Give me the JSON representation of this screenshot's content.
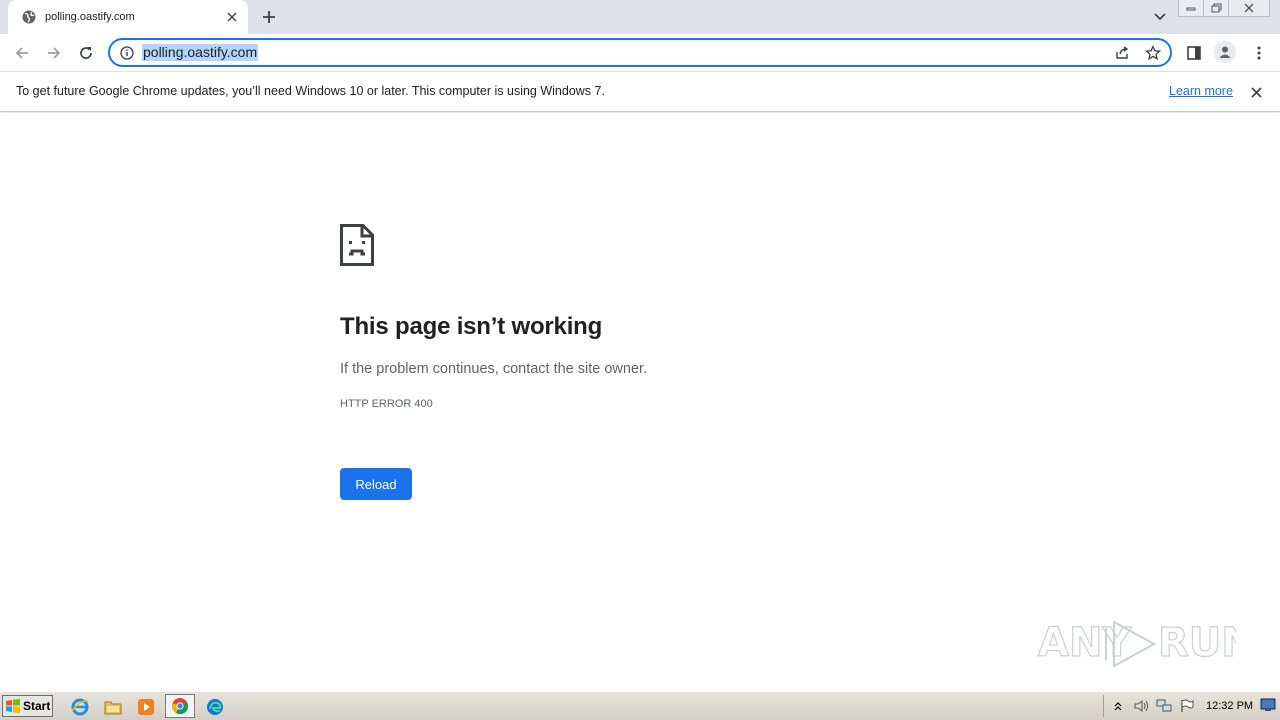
{
  "browser": {
    "tab": {
      "title": "polling.oastify.com"
    },
    "address_bar": {
      "url": "polling.oastify.com"
    },
    "infobar": {
      "message": "To get future Google Chrome updates, you’ll need Windows 10 or later. This computer is using Windows 7.",
      "link_label": "Learn more"
    }
  },
  "error_page": {
    "title": "This page isn’t working",
    "description": "If the problem continues, contact the site owner.",
    "error_code": "HTTP ERROR 400",
    "reload_label": "Reload"
  },
  "watermark": {
    "text": "ANY.RUN"
  },
  "taskbar": {
    "start_label": "Start",
    "clock": "12:32 PM",
    "apps": [
      "internet-explorer",
      "file-explorer",
      "media-player",
      "chrome",
      "edge"
    ]
  },
  "colors": {
    "accent": "#1a73e8",
    "tabstrip": "#dee1e6",
    "url_selection": "#b3d4fc"
  }
}
